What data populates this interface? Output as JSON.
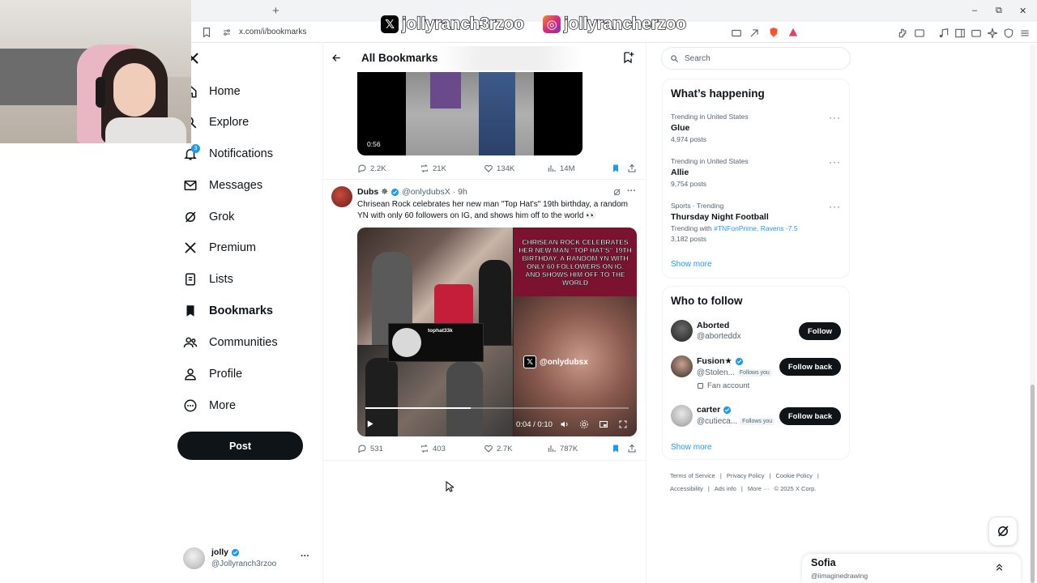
{
  "browser": {
    "url": "x.com/i/bookmarks",
    "new_tab_symbol": "+",
    "window_controls": [
      "–",
      "⧉",
      "✕"
    ]
  },
  "overlay": {
    "x_handle": "jollyranch3rzoo",
    "ig_handle": "jollyrancherzoo"
  },
  "nav": {
    "notifications_badge": "3",
    "items": [
      {
        "label": "Home",
        "icon": "home-icon"
      },
      {
        "label": "Explore",
        "icon": "search-icon"
      },
      {
        "label": "Notifications",
        "icon": "bell-icon"
      },
      {
        "label": "Messages",
        "icon": "envelope-icon"
      },
      {
        "label": "Grok",
        "icon": "grok-icon"
      },
      {
        "label": "Premium",
        "icon": "x-logo-icon"
      },
      {
        "label": "Lists",
        "icon": "list-icon"
      },
      {
        "label": "Bookmarks",
        "icon": "bookmark-icon"
      },
      {
        "label": "Communities",
        "icon": "people-icon"
      },
      {
        "label": "Profile",
        "icon": "person-icon"
      },
      {
        "label": "More",
        "icon": "more-circle-icon"
      }
    ],
    "post_label": "Post",
    "account": {
      "name": "jolly",
      "handle": "@Jollyranch3rzoo",
      "more": "···"
    }
  },
  "header": {
    "title": "All Bookmarks"
  },
  "tweets": [
    {
      "video_duration": "0:56",
      "stats": {
        "replies": "2.2K",
        "reposts": "21K",
        "likes": "134K",
        "views": "14M"
      }
    },
    {
      "author": "Dubs",
      "author_emoji": "✵",
      "handle": "@onlydubsX",
      "time": "· 9h",
      "text": "Chrisean Rock celebrates her new man \"Top Hat's\" 19th birthday, a random YN with only 60 followers on IG, and shows him off to the world 👀",
      "media_caption": "CHRISEAN ROCK CELEBRATES HER NEW MAN \"TOP HAT'S\" 19TH BIRTHDAY, A RANDOM YN WITH ONLY 60 FOLLOWERS ON IG, AND SHOWS HIM OFF TO THE WORLD",
      "inset_username": "tophat33k",
      "watermark": "@onlydubsx",
      "video_time": "0:04 / 0:10",
      "video_progress": 0.4,
      "stats": {
        "replies": "531",
        "reposts": "403",
        "likes": "2.7K",
        "views": "787K"
      }
    }
  ],
  "search": {
    "placeholder": "Search"
  },
  "trending": {
    "title": "What’s happening",
    "items": [
      {
        "meta": "Trending in United States",
        "name": "Glue",
        "posts": "4,974 posts"
      },
      {
        "meta": "Trending in United States",
        "name": "Allie",
        "posts": "9,754 posts"
      },
      {
        "meta": "Sports · Trending",
        "name": "Thursday Night Football",
        "with_label": "Trending with",
        "with_tags": "#TNFonPrime, Ravens -7.5",
        "posts": "3,182 posts"
      }
    ],
    "show_more": "Show more"
  },
  "who_to_follow": {
    "title": "Who to follow",
    "users": [
      {
        "name": "Aborted",
        "handle": "@aborteddx",
        "button": "Follow"
      },
      {
        "name": "Fusion★",
        "handle": "@Stolen...",
        "follows_you": "Follows you",
        "note": "Fan account",
        "button": "Follow back"
      },
      {
        "name": "carter",
        "handle": "@cutieca...",
        "follows_you": "Follows you",
        "button": "Follow back"
      }
    ],
    "show_more": "Show more"
  },
  "footer": {
    "links": [
      "Terms of Service",
      "|",
      "Privacy Policy",
      "|",
      "Cookie Policy",
      "|",
      "Accessibility",
      "|",
      "Ads info",
      "|",
      "More ···",
      "© 2025 X Corp."
    ]
  },
  "messages_drawer": {
    "name": "Sofia",
    "handle": "@iimaginedrawing"
  },
  "colors": {
    "accent": "#1d9bf0",
    "text": "#0f1419",
    "muted": "#536471"
  }
}
